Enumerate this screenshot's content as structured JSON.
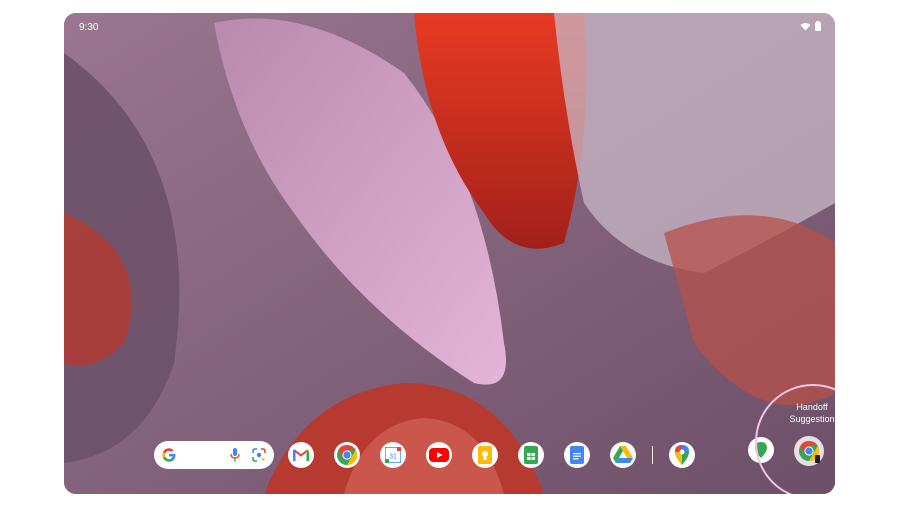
{
  "status_bar": {
    "time": "9:30",
    "wifi_icon": "wifi-icon",
    "battery_icon": "battery-icon"
  },
  "colors": {
    "ring": "#f1c6e8",
    "wallpaper_base": "#8c6a85"
  },
  "dock": {
    "search_bar": {
      "logo_icon": "google-g-icon",
      "mic_icon": "mic-icon",
      "lens_icon": "google-lens-icon"
    },
    "apps": [
      "gmail-icon",
      "chrome-icon",
      "calendar-icon",
      "youtube-icon",
      "keep-icon",
      "sheets-icon",
      "docs-icon",
      "drive-icon",
      "maps-icon"
    ],
    "calendar_day": "31"
  },
  "handoff": {
    "label_line1": "Handoff",
    "label_line2": "Suggestion",
    "app_icon": "chrome-icon"
  }
}
